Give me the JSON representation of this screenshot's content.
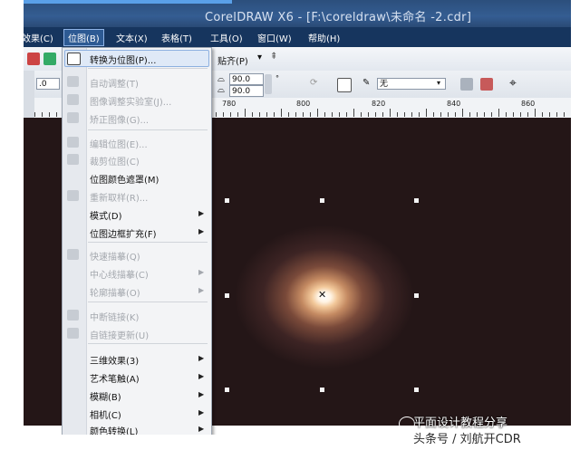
{
  "window": {
    "title": "CorelDRAW X6 - [F:\\coreldraw\\未命名 -2.cdr]"
  },
  "menubar": {
    "items": [
      {
        "label": "效果(C)"
      },
      {
        "label": "位图(B)"
      },
      {
        "label": "文本(X)"
      },
      {
        "label": "表格(T)"
      },
      {
        "label": "工具(O)"
      },
      {
        "label": "窗口(W)"
      },
      {
        "label": "帮助(H)"
      }
    ]
  },
  "toolbar": {
    "snap_label": "贴齐(P)",
    "rotation_value": ".0",
    "angle1": "90.0",
    "angle2": "90.0",
    "outline_value": "无"
  },
  "ruler": {
    "labels": [
      "780",
      "800",
      "820",
      "840",
      "860"
    ]
  },
  "dropdown": {
    "items": [
      {
        "label": "转换为位图(P)...",
        "disabled": false
      },
      {
        "label": "自动调整(T)",
        "disabled": true
      },
      {
        "label": "图像调整实验室(J)...",
        "disabled": true
      },
      {
        "label": "矫正图像(G)...",
        "disabled": true
      },
      {
        "label": "编辑位图(E)...",
        "disabled": true
      },
      {
        "label": "裁剪位图(C)",
        "disabled": true
      },
      {
        "label": "位图颜色遮罩(M)",
        "disabled": false
      },
      {
        "label": "重新取样(R)...",
        "disabled": true
      },
      {
        "label": "模式(D)",
        "disabled": false
      },
      {
        "label": "位图边框扩充(F)",
        "disabled": false
      },
      {
        "label": "快速描摹(Q)",
        "disabled": true
      },
      {
        "label": "中心线描摹(C)",
        "disabled": true
      },
      {
        "label": "轮廓描摹(O)",
        "disabled": true
      },
      {
        "label": "中断链接(K)",
        "disabled": true
      },
      {
        "label": "自链接更新(U)",
        "disabled": true
      },
      {
        "label": "三维效果(3)",
        "disabled": false
      },
      {
        "label": "艺术笔触(A)",
        "disabled": false
      },
      {
        "label": "模糊(B)",
        "disabled": false
      },
      {
        "label": "相机(C)",
        "disabled": false
      },
      {
        "label": "颜色转换(L)",
        "disabled": false
      }
    ]
  },
  "watermark": {
    "line1": "平面设计教程分享",
    "line2": "头条号 / 刘航开CDR"
  },
  "colors": {
    "canvas": "#241617",
    "menubar": "#16355e",
    "titlebar": "#2c4f7c",
    "highlight": "#dfe9f7"
  }
}
